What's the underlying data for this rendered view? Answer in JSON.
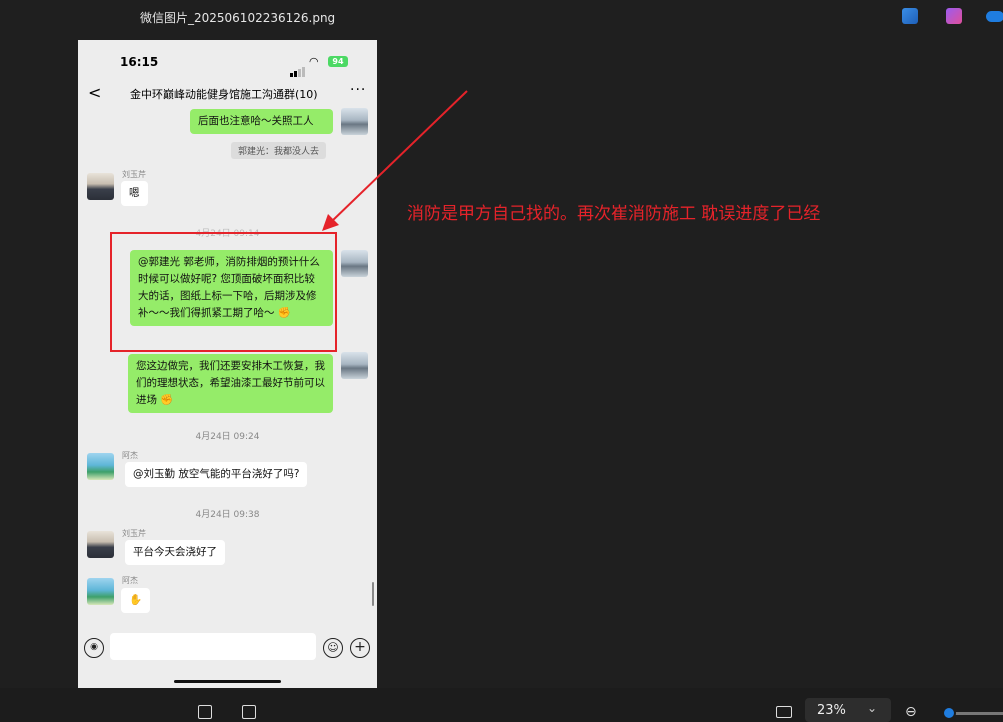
{
  "window": {
    "title": "微信图片_20250610223612​6.png"
  },
  "phone": {
    "status": {
      "time": "16:15",
      "battery": "94"
    },
    "chat": {
      "group_title": "金中环巅峰动能健身馆施工沟通群(10)",
      "back_glyph": "<",
      "more_glyph": "···",
      "messages": {
        "m1": "后面也注意哈～关照工人",
        "sys1": "郭建光：我都没人去",
        "liu_name_1": "刘玉芹",
        "m2": "嗯",
        "ts_faded": "4月24日 09:14",
        "m3": "@郭建光 郭老师，消防排烟的预计什么时候可以做好呢? 您顶面破坏面积比较大的话，图纸上标一下哈，后期涉及修补～～我们得抓紧工期了哈～",
        "m4": "您这边做完，我们还要安排木工恢复，我们的理想状态，希望油漆工最好节前可以进场",
        "ts2": "4月24日 09:24",
        "jie_name_1": "阿杰",
        "m5": "@刘玉勤 放空气能的平台浇好了吗?",
        "ts3": "4月24日 09:38",
        "liu_name_2": "刘玉芹",
        "m6": "平台今天会浇好了",
        "jie_name_2": "阿杰"
      }
    }
  },
  "annotation": {
    "text": "消防是甲方自己找的。再次崔消防施工  耽误进度了已经",
    "color": "#e5232a"
  },
  "viewer": {
    "zoom": "23%"
  },
  "colors": {
    "bubble_green": "#95ec69",
    "background": "#1f1f1f",
    "accent": "#1f7de0"
  }
}
